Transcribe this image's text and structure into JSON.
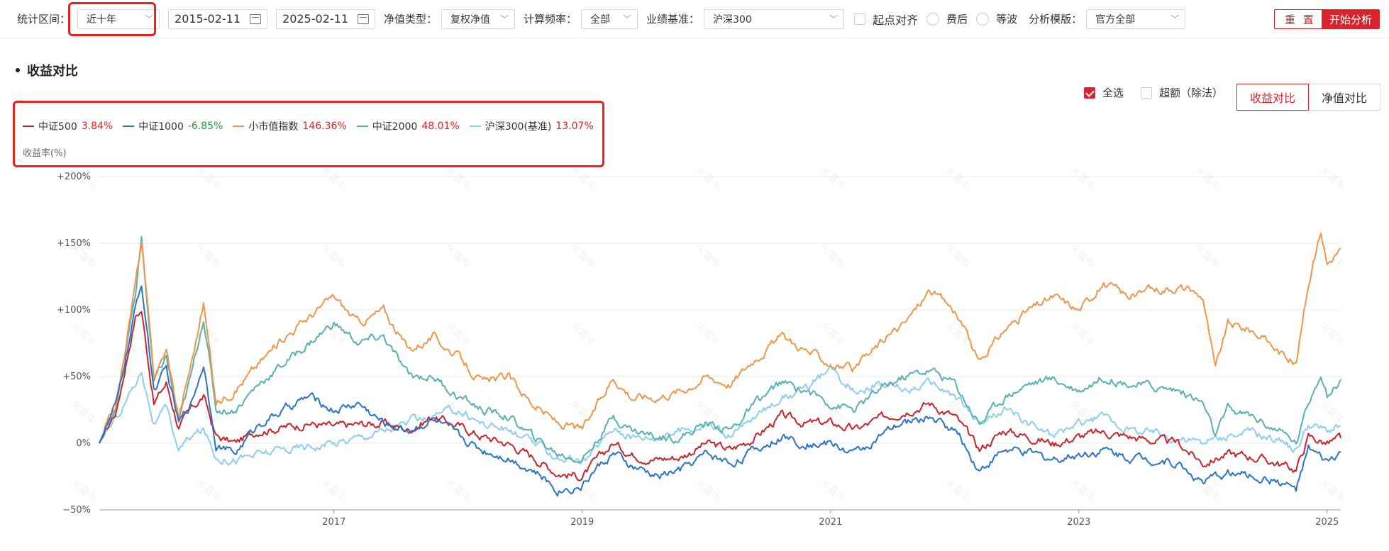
{
  "toolbar": {
    "range_label": "统计区间：",
    "range_value": "近十年",
    "start_date": "2015-02-11",
    "end_date": "2025-02-11",
    "nav_type_label": "净值类型：",
    "nav_type_value": "复权净值",
    "freq_label": "计算频率：",
    "freq_value": "全部",
    "benchmark_label": "业绩基准：",
    "benchmark_value": "沪深300",
    "align_label": "起点对齐",
    "after_fee_label": "费后",
    "equal_wave_label": "等波",
    "template_label": "分析模版：",
    "template_value": "官方全部",
    "reset_label": "重 置",
    "start_label": "开始分析"
  },
  "section": {
    "title": "收益对比"
  },
  "controls": {
    "select_all_label": "全选",
    "excess_label": "超额（除法）",
    "tab_return": "收益对比",
    "tab_nav": "净值对比"
  },
  "colors": {
    "accent": "#d9232d",
    "positive": "#e8221f",
    "negative": "#2e9a2e"
  },
  "chart_data": {
    "type": "line",
    "ylabel": "收益率(%)",
    "ylim": [
      -50,
      200
    ],
    "yticks": [
      -50,
      0,
      50,
      100,
      150,
      200
    ],
    "ytick_labels": [
      "−50%",
      "0%",
      "+50%",
      "+100%",
      "+150%",
      "+200%"
    ],
    "xlim": [
      2015.11,
      2025.11
    ],
    "xticks": [
      2017,
      2019,
      2021,
      2023,
      2025
    ],
    "xtick_labels": [
      "2017",
      "2019",
      "2021",
      "2023",
      "2025"
    ],
    "grid": "horizontal",
    "legend_position": "top-left",
    "series": [
      {
        "name": "中证500",
        "final": "3.84%",
        "color": "#c8242b",
        "points": [
          [
            2015.11,
            0
          ],
          [
            2015.25,
            25
          ],
          [
            2015.4,
            95
          ],
          [
            2015.45,
            100
          ],
          [
            2015.55,
            30
          ],
          [
            2015.65,
            45
          ],
          [
            2015.75,
            12
          ],
          [
            2015.85,
            25
          ],
          [
            2015.95,
            35
          ],
          [
            2016.05,
            5
          ],
          [
            2016.2,
            0
          ],
          [
            2016.4,
            10
          ],
          [
            2016.6,
            12
          ],
          [
            2016.8,
            15
          ],
          [
            2017.0,
            12
          ],
          [
            2017.2,
            14
          ],
          [
            2017.4,
            15
          ],
          [
            2017.6,
            10
          ],
          [
            2017.8,
            20
          ],
          [
            2018.0,
            13
          ],
          [
            2018.2,
            5
          ],
          [
            2018.4,
            0
          ],
          [
            2018.6,
            -10
          ],
          [
            2018.8,
            -22
          ],
          [
            2019.0,
            -25
          ],
          [
            2019.1,
            -15
          ],
          [
            2019.25,
            0
          ],
          [
            2019.4,
            -8
          ],
          [
            2019.6,
            -12
          ],
          [
            2019.8,
            -10
          ],
          [
            2020.0,
            0
          ],
          [
            2020.2,
            -5
          ],
          [
            2020.4,
            5
          ],
          [
            2020.6,
            20
          ],
          [
            2020.8,
            15
          ],
          [
            2021.0,
            15
          ],
          [
            2021.2,
            10
          ],
          [
            2021.4,
            18
          ],
          [
            2021.6,
            25
          ],
          [
            2021.8,
            30
          ],
          [
            2022.0,
            20
          ],
          [
            2022.2,
            -5
          ],
          [
            2022.4,
            10
          ],
          [
            2022.6,
            5
          ],
          [
            2022.8,
            0
          ],
          [
            2023.0,
            5
          ],
          [
            2023.2,
            8
          ],
          [
            2023.4,
            5
          ],
          [
            2023.6,
            2
          ],
          [
            2023.8,
            0
          ],
          [
            2024.0,
            -15
          ],
          [
            2024.2,
            -8
          ],
          [
            2024.4,
            -10
          ],
          [
            2024.6,
            -15
          ],
          [
            2024.75,
            -20
          ],
          [
            2024.85,
            5
          ],
          [
            2025.0,
            0
          ],
          [
            2025.11,
            3.84
          ]
        ]
      },
      {
        "name": "中证1000",
        "final": "-6.85%",
        "color": "#2c72c5",
        "points": [
          [
            2015.11,
            0
          ],
          [
            2015.25,
            30
          ],
          [
            2015.4,
            100
          ],
          [
            2015.45,
            120
          ],
          [
            2015.55,
            40
          ],
          [
            2015.65,
            55
          ],
          [
            2015.75,
            15
          ],
          [
            2015.85,
            30
          ],
          [
            2015.95,
            60
          ],
          [
            2016.05,
            0
          ],
          [
            2016.2,
            -8
          ],
          [
            2016.4,
            15
          ],
          [
            2016.6,
            25
          ],
          [
            2016.8,
            35
          ],
          [
            2017.0,
            25
          ],
          [
            2017.2,
            30
          ],
          [
            2017.4,
            15
          ],
          [
            2017.6,
            10
          ],
          [
            2017.8,
            18
          ],
          [
            2018.0,
            5
          ],
          [
            2018.2,
            -5
          ],
          [
            2018.4,
            -10
          ],
          [
            2018.6,
            -20
          ],
          [
            2018.8,
            -35
          ],
          [
            2019.0,
            -32
          ],
          [
            2019.1,
            -20
          ],
          [
            2019.25,
            -8
          ],
          [
            2019.4,
            -18
          ],
          [
            2019.6,
            -25
          ],
          [
            2019.8,
            -20
          ],
          [
            2020.0,
            -8
          ],
          [
            2020.2,
            -15
          ],
          [
            2020.4,
            -5
          ],
          [
            2020.6,
            5
          ],
          [
            2020.8,
            0
          ],
          [
            2021.0,
            0
          ],
          [
            2021.2,
            -8
          ],
          [
            2021.4,
            5
          ],
          [
            2021.6,
            15
          ],
          [
            2021.8,
            20
          ],
          [
            2022.0,
            10
          ],
          [
            2022.2,
            -20
          ],
          [
            2022.4,
            -5
          ],
          [
            2022.6,
            -8
          ],
          [
            2022.8,
            -12
          ],
          [
            2023.0,
            -8
          ],
          [
            2023.2,
            -5
          ],
          [
            2023.4,
            -10
          ],
          [
            2023.6,
            -12
          ],
          [
            2023.8,
            -15
          ],
          [
            2024.0,
            -30
          ],
          [
            2024.2,
            -22
          ],
          [
            2024.4,
            -25
          ],
          [
            2024.6,
            -28
          ],
          [
            2024.75,
            -35
          ],
          [
            2024.85,
            -5
          ],
          [
            2025.0,
            -15
          ],
          [
            2025.11,
            -6.85
          ]
        ]
      },
      {
        "name": "小市值指数",
        "final": "146.36%",
        "color": "#f0954a",
        "points": [
          [
            2015.11,
            0
          ],
          [
            2015.25,
            30
          ],
          [
            2015.4,
            120
          ],
          [
            2015.45,
            150
          ],
          [
            2015.55,
            50
          ],
          [
            2015.65,
            70
          ],
          [
            2015.75,
            20
          ],
          [
            2015.85,
            60
          ],
          [
            2015.95,
            105
          ],
          [
            2016.05,
            30
          ],
          [
            2016.2,
            40
          ],
          [
            2016.4,
            60
          ],
          [
            2016.6,
            80
          ],
          [
            2016.8,
            95
          ],
          [
            2017.0,
            110
          ],
          [
            2017.2,
            90
          ],
          [
            2017.4,
            100
          ],
          [
            2017.6,
            70
          ],
          [
            2017.8,
            80
          ],
          [
            2018.0,
            65
          ],
          [
            2018.2,
            45
          ],
          [
            2018.4,
            50
          ],
          [
            2018.6,
            30
          ],
          [
            2018.8,
            15
          ],
          [
            2019.0,
            10
          ],
          [
            2019.1,
            25
          ],
          [
            2019.25,
            50
          ],
          [
            2019.4,
            35
          ],
          [
            2019.6,
            35
          ],
          [
            2019.8,
            40
          ],
          [
            2020.0,
            50
          ],
          [
            2020.2,
            45
          ],
          [
            2020.4,
            65
          ],
          [
            2020.6,
            80
          ],
          [
            2020.8,
            70
          ],
          [
            2021.0,
            60
          ],
          [
            2021.2,
            55
          ],
          [
            2021.4,
            75
          ],
          [
            2021.6,
            90
          ],
          [
            2021.8,
            115
          ],
          [
            2022.0,
            100
          ],
          [
            2022.2,
            60
          ],
          [
            2022.4,
            85
          ],
          [
            2022.6,
            100
          ],
          [
            2022.8,
            110
          ],
          [
            2023.0,
            100
          ],
          [
            2023.2,
            120
          ],
          [
            2023.4,
            110
          ],
          [
            2023.6,
            115
          ],
          [
            2023.8,
            118
          ],
          [
            2024.0,
            110
          ],
          [
            2024.1,
            55
          ],
          [
            2024.2,
            90
          ],
          [
            2024.4,
            85
          ],
          [
            2024.6,
            70
          ],
          [
            2024.75,
            60
          ],
          [
            2024.85,
            120
          ],
          [
            2024.95,
            160
          ],
          [
            2025.0,
            135
          ],
          [
            2025.11,
            146.36
          ]
        ]
      },
      {
        "name": "中证2000",
        "final": "48.01%",
        "color": "#58b0b0",
        "points": [
          [
            2015.11,
            0
          ],
          [
            2015.25,
            30
          ],
          [
            2015.4,
            110
          ],
          [
            2015.45,
            155
          ],
          [
            2015.55,
            45
          ],
          [
            2015.65,
            65
          ],
          [
            2015.75,
            15
          ],
          [
            2015.85,
            50
          ],
          [
            2015.95,
            95
          ],
          [
            2016.05,
            25
          ],
          [
            2016.2,
            25
          ],
          [
            2016.4,
            45
          ],
          [
            2016.6,
            60
          ],
          [
            2016.8,
            75
          ],
          [
            2017.0,
            90
          ],
          [
            2017.2,
            75
          ],
          [
            2017.4,
            80
          ],
          [
            2017.6,
            50
          ],
          [
            2017.8,
            50
          ],
          [
            2018.0,
            35
          ],
          [
            2018.2,
            25
          ],
          [
            2018.4,
            20
          ],
          [
            2018.6,
            5
          ],
          [
            2018.8,
            -8
          ],
          [
            2019.0,
            -12
          ],
          [
            2019.1,
            0
          ],
          [
            2019.25,
            20
          ],
          [
            2019.4,
            10
          ],
          [
            2019.6,
            5
          ],
          [
            2019.8,
            5
          ],
          [
            2020.0,
            15
          ],
          [
            2020.2,
            10
          ],
          [
            2020.4,
            30
          ],
          [
            2020.6,
            45
          ],
          [
            2020.8,
            40
          ],
          [
            2021.0,
            30
          ],
          [
            2021.2,
            25
          ],
          [
            2021.4,
            40
          ],
          [
            2021.6,
            50
          ],
          [
            2021.8,
            55
          ],
          [
            2022.0,
            45
          ],
          [
            2022.2,
            15
          ],
          [
            2022.4,
            35
          ],
          [
            2022.6,
            45
          ],
          [
            2022.8,
            48
          ],
          [
            2023.0,
            40
          ],
          [
            2023.2,
            50
          ],
          [
            2023.4,
            45
          ],
          [
            2023.6,
            42
          ],
          [
            2023.8,
            40
          ],
          [
            2024.0,
            30
          ],
          [
            2024.1,
            5
          ],
          [
            2024.2,
            25
          ],
          [
            2024.4,
            20
          ],
          [
            2024.6,
            10
          ],
          [
            2024.75,
            0
          ],
          [
            2024.85,
            30
          ],
          [
            2024.95,
            55
          ],
          [
            2025.0,
            35
          ],
          [
            2025.11,
            48.01
          ]
        ]
      },
      {
        "name": "沪深300(基准)",
        "final": "13.07%",
        "color": "#8ecdf2",
        "points": [
          [
            2015.11,
            0
          ],
          [
            2015.25,
            20
          ],
          [
            2015.4,
            45
          ],
          [
            2015.45,
            55
          ],
          [
            2015.55,
            15
          ],
          [
            2015.65,
            25
          ],
          [
            2015.75,
            -5
          ],
          [
            2015.85,
            5
          ],
          [
            2015.95,
            10
          ],
          [
            2016.05,
            -10
          ],
          [
            2016.2,
            -12
          ],
          [
            2016.4,
            -8
          ],
          [
            2016.6,
            -5
          ],
          [
            2016.8,
            -2
          ],
          [
            2017.0,
            0
          ],
          [
            2017.2,
            5
          ],
          [
            2017.4,
            10
          ],
          [
            2017.6,
            15
          ],
          [
            2017.8,
            20
          ],
          [
            2018.0,
            25
          ],
          [
            2018.2,
            15
          ],
          [
            2018.4,
            10
          ],
          [
            2018.6,
            0
          ],
          [
            2018.8,
            -10
          ],
          [
            2019.0,
            -15
          ],
          [
            2019.1,
            -5
          ],
          [
            2019.25,
            12
          ],
          [
            2019.4,
            5
          ],
          [
            2019.6,
            5
          ],
          [
            2019.8,
            10
          ],
          [
            2020.0,
            15
          ],
          [
            2020.2,
            5
          ],
          [
            2020.4,
            20
          ],
          [
            2020.6,
            35
          ],
          [
            2020.8,
            40
          ],
          [
            2021.0,
            55
          ],
          [
            2021.2,
            40
          ],
          [
            2021.4,
            45
          ],
          [
            2021.6,
            40
          ],
          [
            2021.8,
            45
          ],
          [
            2022.0,
            35
          ],
          [
            2022.2,
            15
          ],
          [
            2022.4,
            25
          ],
          [
            2022.6,
            15
          ],
          [
            2022.8,
            5
          ],
          [
            2023.0,
            15
          ],
          [
            2023.2,
            20
          ],
          [
            2023.4,
            10
          ],
          [
            2023.6,
            8
          ],
          [
            2023.8,
            5
          ],
          [
            2024.0,
            0
          ],
          [
            2024.2,
            5
          ],
          [
            2024.4,
            8
          ],
          [
            2024.6,
            3
          ],
          [
            2024.75,
            -5
          ],
          [
            2024.85,
            15
          ],
          [
            2025.0,
            10
          ],
          [
            2025.11,
            13.07
          ]
        ]
      }
    ]
  },
  "watermark": "火富牛"
}
